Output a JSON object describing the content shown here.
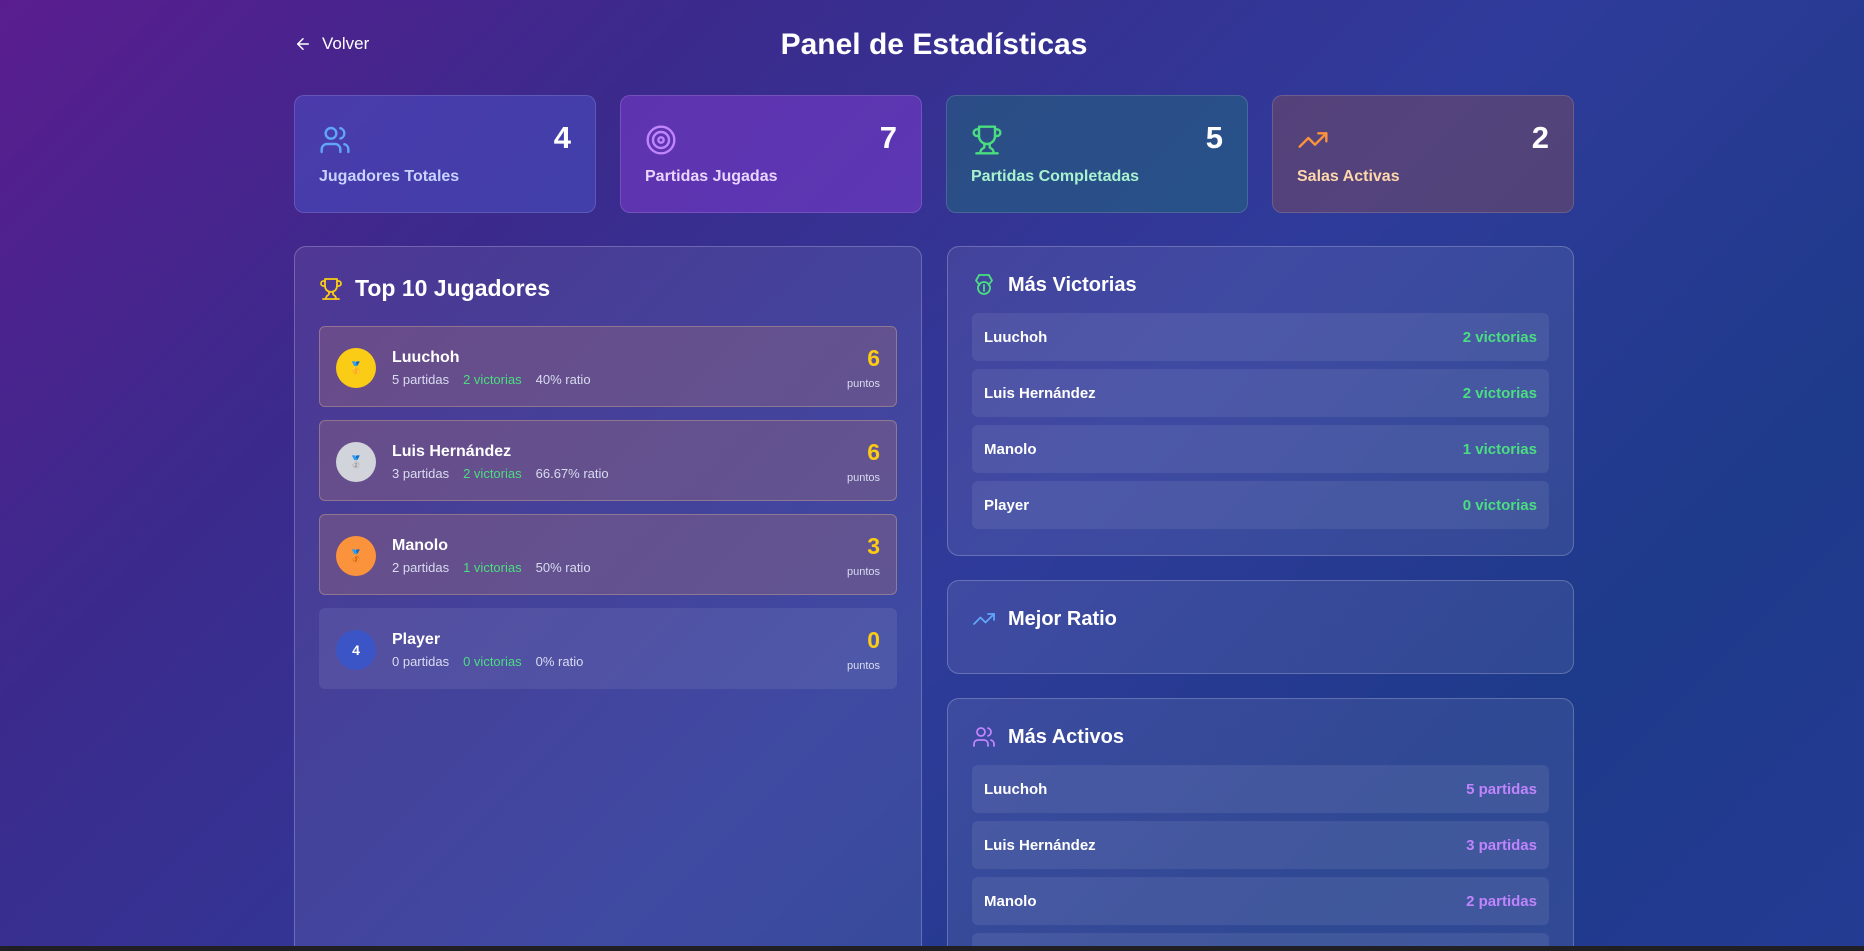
{
  "header": {
    "back_label": "Volver",
    "title": "Panel de Estadísticas"
  },
  "stats": [
    {
      "value": "4",
      "label": "Jugadores Totales",
      "icon": "users-icon"
    },
    {
      "value": "7",
      "label": "Partidas Jugadas",
      "icon": "target-icon"
    },
    {
      "value": "5",
      "label": "Partidas Completadas",
      "icon": "trophy-icon"
    },
    {
      "value": "2",
      "label": "Salas Activas",
      "icon": "trending-up-icon"
    }
  ],
  "top10": {
    "title": "Top 10 Jugadores",
    "players": [
      {
        "rank": "1",
        "medal": "gold",
        "name": "Luuchoh",
        "partidas": "5 partidas",
        "victorias": "2 victorias",
        "ratio": "40% ratio",
        "points": "6",
        "points_label": "puntos"
      },
      {
        "rank": "2",
        "medal": "silver",
        "name": "Luis Hernández",
        "partidas": "3 partidas",
        "victorias": "2 victorias",
        "ratio": "66.67% ratio",
        "points": "6",
        "points_label": "puntos"
      },
      {
        "rank": "3",
        "medal": "bronze",
        "name": "Manolo",
        "partidas": "2 partidas",
        "victorias": "1 victorias",
        "ratio": "50% ratio",
        "points": "3",
        "points_label": "puntos"
      },
      {
        "rank": "4",
        "medal": "none",
        "name": "Player",
        "partidas": "0 partidas",
        "victorias": "0 victorias",
        "ratio": "0% ratio",
        "points": "0",
        "points_label": "puntos"
      }
    ]
  },
  "mas_victorias": {
    "title": "Más Victorias",
    "rows": [
      {
        "name": "Luuchoh",
        "value": "2 victorias"
      },
      {
        "name": "Luis Hernández",
        "value": "2 victorias"
      },
      {
        "name": "Manolo",
        "value": "1 victorias"
      },
      {
        "name": "Player",
        "value": "0 victorias"
      }
    ]
  },
  "mejor_ratio": {
    "title": "Mejor Ratio"
  },
  "mas_activos": {
    "title": "Más Activos",
    "rows": [
      {
        "name": "Luuchoh",
        "value": "5 partidas"
      },
      {
        "name": "Luis Hernández",
        "value": "3 partidas"
      },
      {
        "name": "Manolo",
        "value": "2 partidas"
      }
    ]
  },
  "colors": {
    "gold": "#facc15",
    "green": "#4ade80",
    "purple": "#c084fc",
    "blue_icon": "#60a5fa",
    "orange_icon": "#fb923c"
  }
}
